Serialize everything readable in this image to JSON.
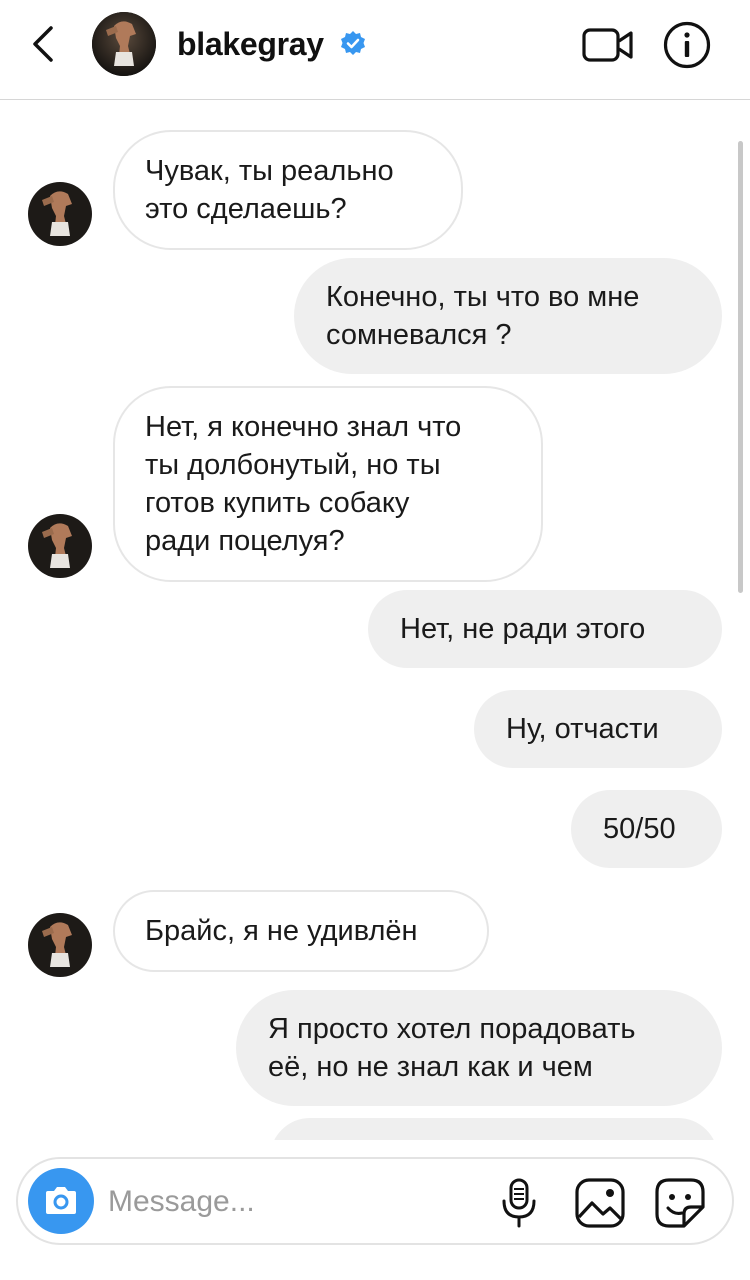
{
  "header": {
    "username": "blakegray",
    "verified": true,
    "accent": "#3897f0"
  },
  "icons": {
    "back": "chevron-left-icon",
    "verified": "verified-badge-icon",
    "video": "video-camera-icon",
    "info": "info-icon",
    "camera": "camera-icon",
    "mic": "microphone-icon",
    "gallery": "gallery-icon",
    "sticker": "sticker-icon"
  },
  "messages": [
    {
      "from": "them",
      "text": "Чувак, ты реально\nэто сделаешь?"
    },
    {
      "from": "me",
      "text": "Конечно, ты что во мне\nсомневался ?"
    },
    {
      "from": "them",
      "text": "Нет, я конечно знал что\nты долбонутый, но ты\nготов купить собаку\nради поцелуя?"
    },
    {
      "from": "me",
      "text": "Нет, не ради этого"
    },
    {
      "from": "me",
      "text": "Ну, отчасти"
    },
    {
      "from": "me",
      "text": "50/50"
    },
    {
      "from": "them",
      "text": "Брайс, я не удивлён"
    },
    {
      "from": "me",
      "text": "Я просто хотел порадовать\neё, но не знал как и чем"
    }
  ],
  "composer": {
    "placeholder": "Message..."
  }
}
